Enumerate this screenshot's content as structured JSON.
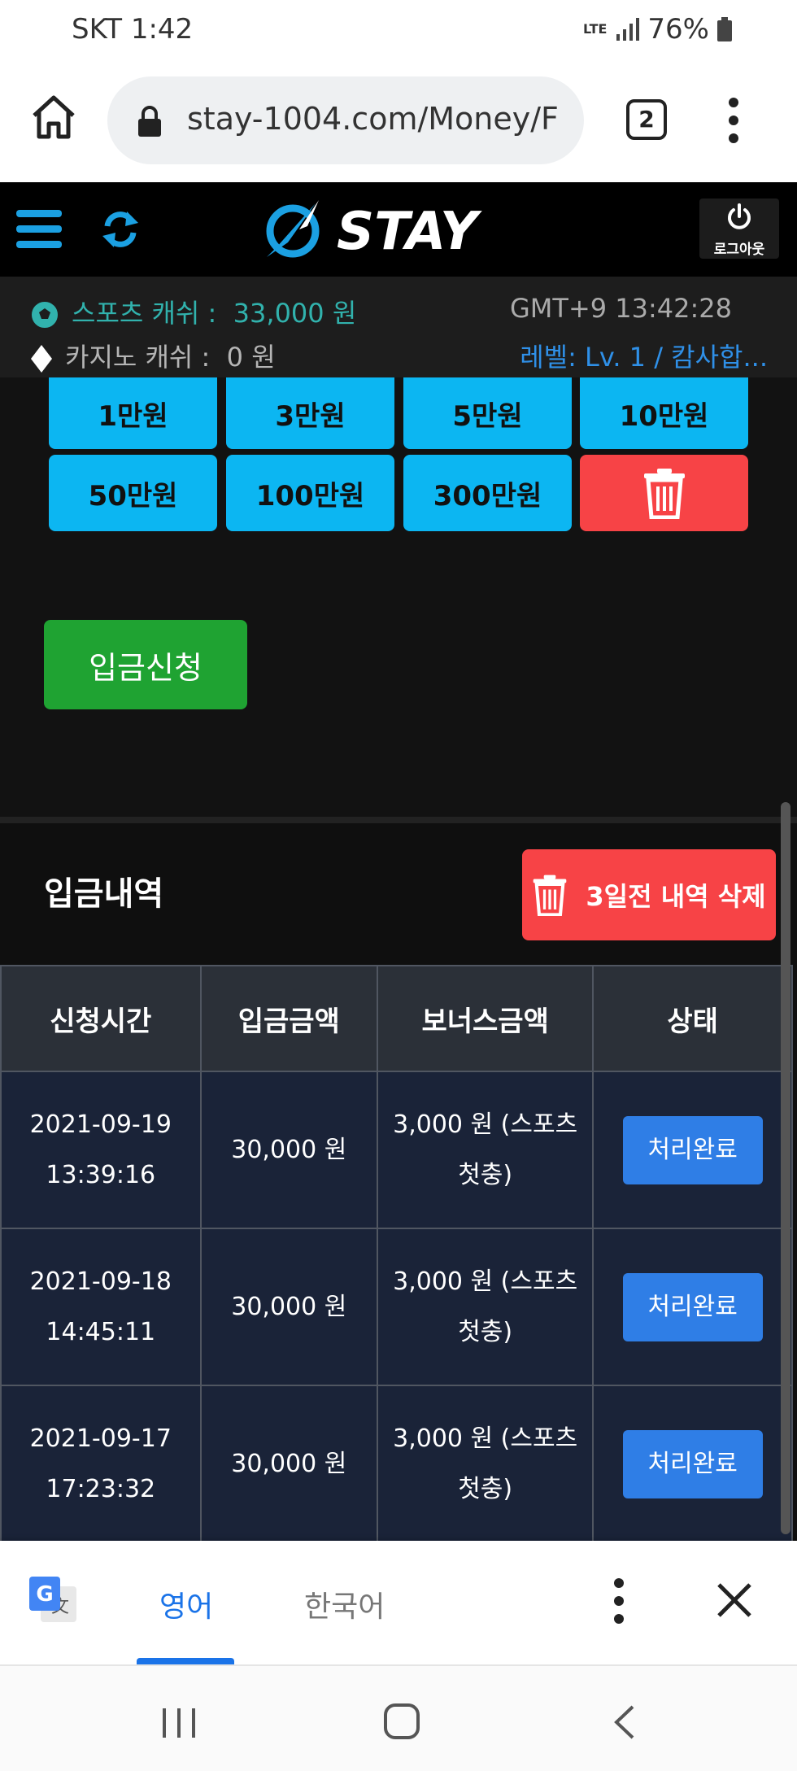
{
  "status_bar": {
    "carrier_time": "SKT  1:42",
    "network": "LTE",
    "battery": "76%"
  },
  "browser": {
    "url": "stay-1004.com/Money/F",
    "tab_count": "2"
  },
  "header": {
    "logo_text": "STAY",
    "logout_label": "로그아웃"
  },
  "cash": {
    "sports_label": "스포츠 캐쉬 :",
    "sports_value": "33,000 원",
    "casino_label": "카지노 캐쉬 :",
    "casino_value": "0 원",
    "gmt": "GMT+9 13:42:28",
    "level": "레벨: Lv. 1 / 캄사합..."
  },
  "amount_buttons": [
    "1만원",
    "3만원",
    "5만원",
    "10만원",
    "50만원",
    "100만원",
    "300만원"
  ],
  "deposit_button": "입금신청",
  "history": {
    "title": "입금내역",
    "delete_label": "3일전 내역 삭제",
    "columns": [
      "신청시간",
      "입금금액",
      "보너스금액",
      "상태"
    ],
    "rows": [
      {
        "date": "2021-09-19",
        "time": "13:39:16",
        "amount": "30,000 원",
        "bonus_line1": "3,000 원 (스포츠",
        "bonus_line2": "첫충)",
        "status": "처리완료"
      },
      {
        "date": "2021-09-18",
        "time": "14:45:11",
        "amount": "30,000 원",
        "bonus_line1": "3,000 원 (스포츠",
        "bonus_line2": "첫충)",
        "status": "처리완료"
      },
      {
        "date": "2021-09-17",
        "time": "17:23:32",
        "amount": "30,000 원",
        "bonus_line1": "3,000 원 (스포츠",
        "bonus_line2": "첫충)",
        "status": "처리완료"
      }
    ]
  },
  "translate": {
    "lang_selected": "영어",
    "lang_other": "한국어"
  },
  "colors": {
    "accent_blue": "#0cb6f2",
    "delete_red": "#f74346",
    "deposit_green": "#1fa332",
    "status_blue": "#2f7ee6"
  }
}
